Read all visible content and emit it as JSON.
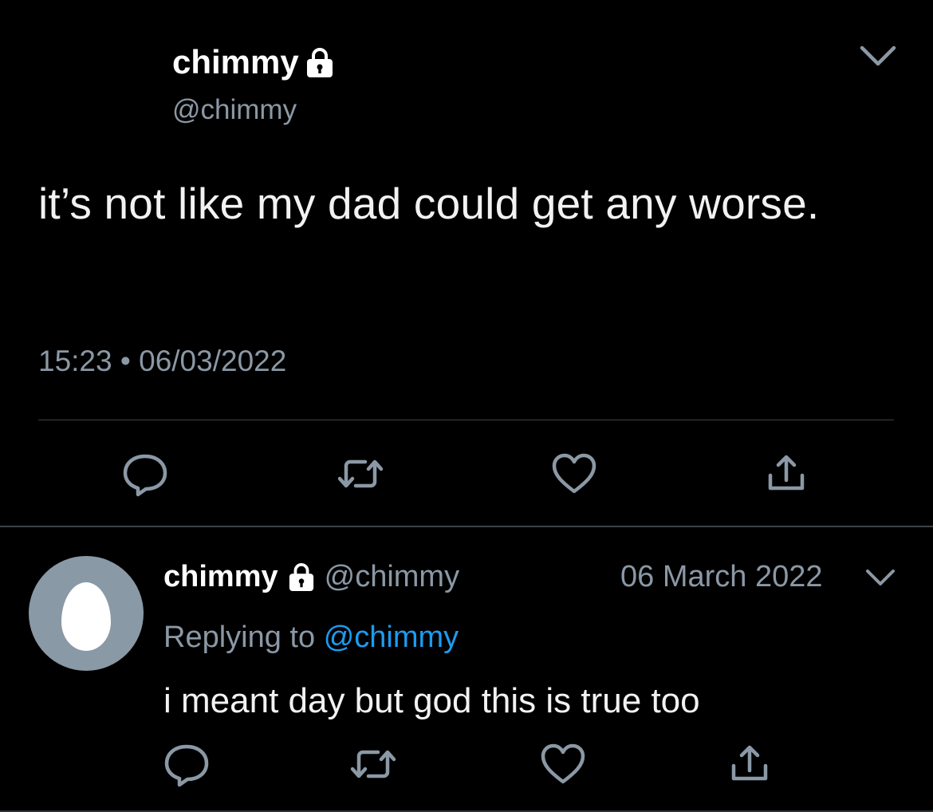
{
  "main_tweet": {
    "display_name": "chimmy",
    "handle": "@chimmy",
    "text": "it’s not like my dad could get any worse.",
    "time": "15:23",
    "separator": "•",
    "date": "06/03/2022",
    "icons": [
      "lock-icon",
      "chevron-down-icon",
      "reply-icon",
      "retweet-icon",
      "like-icon",
      "share-icon"
    ]
  },
  "reply_tweet": {
    "display_name": "chimmy",
    "handle": "@chimmy",
    "date": "06 March 2022",
    "replying_prefix": "Replying to",
    "replying_to": "@chimmy",
    "text": "i meant day but god this is true too",
    "icons": [
      "lock-icon",
      "chevron-down-icon",
      "reply-icon",
      "retweet-icon",
      "like-icon",
      "share-icon"
    ]
  },
  "colors": {
    "background": "#000000",
    "muted_text": "#8b98a5",
    "link": "#1d9bf0",
    "avatar": "#8a99a6"
  }
}
